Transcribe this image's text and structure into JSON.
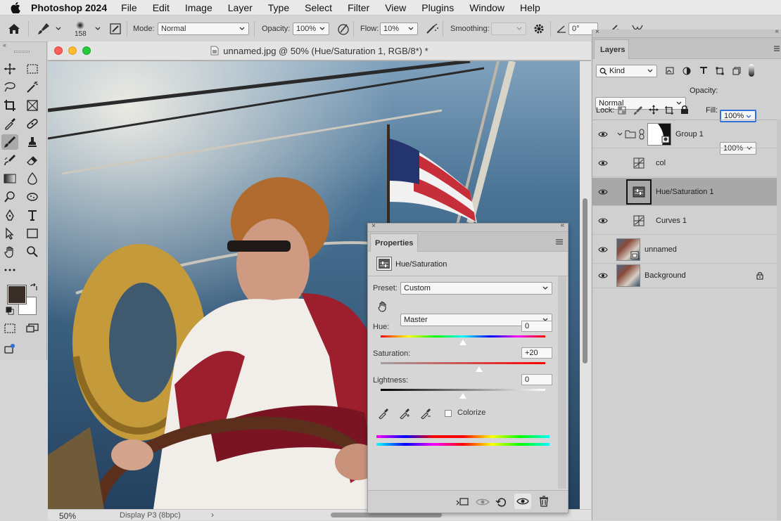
{
  "menubar": {
    "app_name": "Photoshop 2024",
    "items": [
      "File",
      "Edit",
      "Image",
      "Layer",
      "Type",
      "Select",
      "Filter",
      "View",
      "Plugins",
      "Window",
      "Help"
    ]
  },
  "options_bar": {
    "brush_size": "158",
    "mode_label": "Mode:",
    "mode_value": "Normal",
    "opacity_label": "Opacity:",
    "opacity_value": "100%",
    "flow_label": "Flow:",
    "flow_value": "10%",
    "smoothing_label": "Smoothing:",
    "smoothing_value": "",
    "angle_value": "0°"
  },
  "document": {
    "title": "unnamed.jpg @ 50% (Hue/Saturation 1, RGB/8*) *",
    "zoom": "50%",
    "profile": "Display P3 (8bpc)"
  },
  "properties": {
    "tab_label": "Properties",
    "adjustment_name": "Hue/Saturation",
    "preset_label": "Preset:",
    "preset_value": "Custom",
    "channel_value": "Master",
    "hue_label": "Hue:",
    "hue_value": "0",
    "hue_position": 0.5,
    "saturation_label": "Saturation:",
    "saturation_value": "+20",
    "saturation_position": 0.6,
    "lightness_label": "Lightness:",
    "lightness_value": "0",
    "lightness_position": 0.5,
    "colorize_label": "Colorize",
    "colorize_checked": false
  },
  "layers_panel": {
    "tab_label": "Layers",
    "filter_kind": "Kind",
    "blend_mode": "Normal",
    "opacity_label": "Opacity:",
    "opacity_value": "100%",
    "lock_label": "Lock:",
    "fill_label": "Fill:",
    "fill_value": "100%",
    "layers": [
      {
        "name": "Group 1",
        "type": "group",
        "visible": true
      },
      {
        "name": "col",
        "type": "adjustment",
        "visible": true
      },
      {
        "name": "Hue/Saturation 1",
        "type": "adjustment",
        "visible": true,
        "selected": true
      },
      {
        "name": "Curves 1",
        "type": "adjustment",
        "visible": true
      },
      {
        "name": "unnamed",
        "type": "smart-object",
        "visible": true
      },
      {
        "name": "Background",
        "type": "image",
        "visible": true,
        "locked": true
      }
    ]
  },
  "colors": {
    "foreground": "#3a2e28",
    "background": "#ffffff",
    "selection": "#a8a8a8",
    "accent_blue": "#2f6fd6"
  }
}
